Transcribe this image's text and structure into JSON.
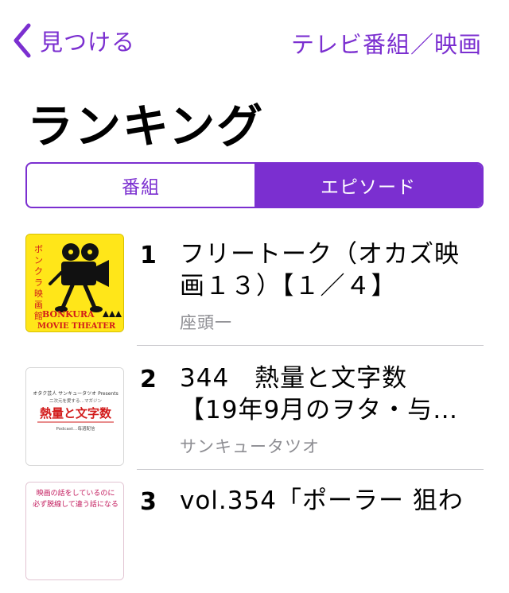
{
  "nav": {
    "back_label": "見つける",
    "title": "テレビ番組／映画"
  },
  "page": {
    "title": "ランキング"
  },
  "segment": {
    "options": [
      "番組",
      "エピソード"
    ],
    "selected": "エピソード"
  },
  "episodes": [
    {
      "rank": "1",
      "title_line1": "フリートーク（オカズ映",
      "title_line2": "画１３）【１／４】",
      "author": "座頭一",
      "thumb": {
        "vertical_text": "ボンクラ映画館",
        "caption_line1": "BONKURA",
        "caption_line2": "MOVIE THEATER",
        "bg": "#ffe619",
        "accent": "#d21a1a"
      }
    },
    {
      "rank": "2",
      "title_line1": "344　熱量と文字数",
      "title_line2": "【19年9月のヲタ・与…",
      "author": "サンキュータツオ",
      "thumb": {
        "top_text": "オタク芸人 サンキュータツオ Presents",
        "sub_text": "二次元を愛する…マガジン",
        "main_text": "熱量と文字数",
        "bottom_text": "Podcast…毎週配信",
        "accent": "#d21a1a"
      }
    },
    {
      "rank": "3",
      "title_line1": "vol.354「ポーラー 狙わ",
      "thumb": {
        "line1": "映画の話をしているのに",
        "line2": "必ず脱線して違う話になる",
        "accent": "#c2185b"
      }
    }
  ],
  "colors": {
    "accent": "#7b2fd0",
    "secondary_text": "#8e8e93",
    "separator": "#c8c7cc"
  }
}
